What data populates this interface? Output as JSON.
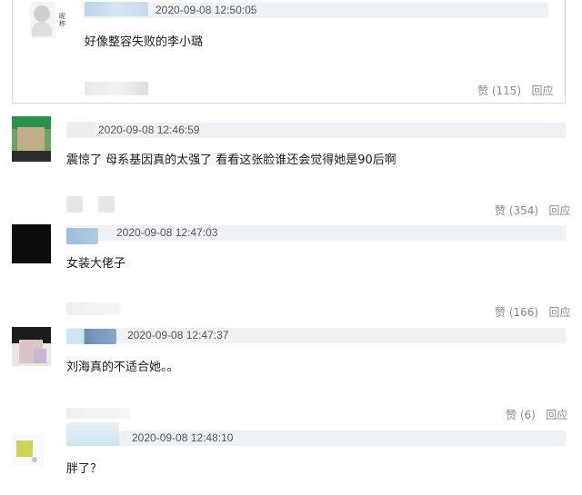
{
  "quoted_comment": {
    "timestamp": "2020-09-08 12:50:05",
    "text": "好像整容失败的李小璐",
    "like_label": "赞 (115)",
    "reply_label": "回应",
    "avatar_caption": "昵称"
  },
  "comments": [
    {
      "timestamp": "2020-09-08 12:46:59",
      "text": "震惊了 母系基因真的太强了 看看这张脸谁还会觉得她是90后啊",
      "like_label": "赞 (354)",
      "reply_label": "回应"
    },
    {
      "timestamp": "2020-09-08 12:47:03",
      "text": "女装大佬子",
      "like_label": "赞 (166)",
      "reply_label": "回应"
    },
    {
      "timestamp": "2020-09-08 12:47:37",
      "text": "刘海真的不适合她。。",
      "like_label": "赞 (6)",
      "reply_label": "回应"
    },
    {
      "timestamp": "2020-09-08 12:48:10",
      "text": "胖了？"
    }
  ],
  "colors": {
    "meta_bar": "#eef2f5",
    "action_text": "#8a8a8a",
    "border": "#d8d8d8"
  }
}
